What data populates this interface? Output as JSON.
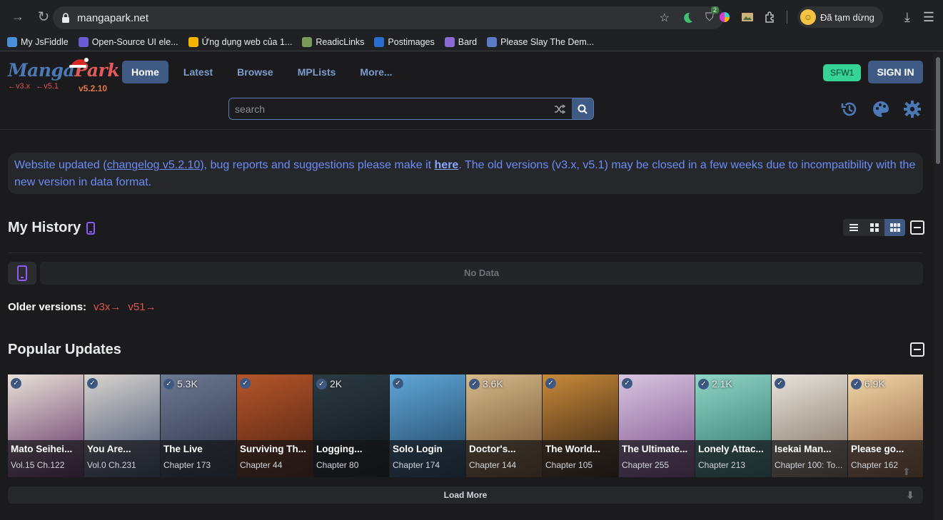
{
  "browser": {
    "url": "mangapark.net",
    "profile_status": "Đã tạm dừng",
    "extension_badge": "2",
    "bookmarks": [
      {
        "label": "My JsFiddle",
        "color": "#4a90d9"
      },
      {
        "label": "Open-Source UI ele...",
        "color": "#6b5bd6"
      },
      {
        "label": "Ứng dụng web của 1...",
        "color": "#f4b400"
      },
      {
        "label": "ReadicLinks",
        "color": "#7a9a5a"
      },
      {
        "label": "Postimages",
        "color": "#2b6ccf"
      },
      {
        "label": "Bard",
        "color": "#8a6bd6"
      },
      {
        "label": "Please Slay The Dem...",
        "color": "#5a7cc4"
      }
    ]
  },
  "site": {
    "logo_manga": "Manga",
    "logo_park": "Park",
    "legacy_v3": "←v3.x",
    "legacy_v5": "←v5.1",
    "version": "v5.2.10",
    "nav": [
      {
        "label": "Home",
        "active": true
      },
      {
        "label": "Latest",
        "active": false
      },
      {
        "label": "Browse",
        "active": false
      },
      {
        "label": "MPLists",
        "active": false
      },
      {
        "label": "More...",
        "active": false
      }
    ],
    "sfw_label": "SFW1",
    "signin_label": "SIGN IN",
    "search_placeholder": "search",
    "notice_pre": "Website updated (",
    "notice_link": "changelog v5.2.10",
    "notice_mid": "), bug reports and suggestions please make it ",
    "notice_here": "here",
    "notice_post": ". The old versions (v3.x, v5.1) may be closed in a few weeks due to incompatibility with the new version in data format.",
    "history_title": "My History",
    "nodata": "No Data",
    "older_label": "Older versions:",
    "older_v3": "v3x→",
    "older_v5": "v51→",
    "popular_title": "Popular Updates",
    "load_more": "Load More"
  },
  "cards": [
    {
      "name": "Mato Seihei...",
      "chapter": "Vol.15 Ch.122",
      "views": "",
      "c1": "#e9e2d8",
      "c2": "#5a2a5e"
    },
    {
      "name": "You Are...",
      "chapter": "Vol.0 Ch.231",
      "views": "",
      "c1": "#d9d4cf",
      "c2": "#3a4a6a"
    },
    {
      "name": "The Live",
      "chapter": "Chapter 173",
      "views": "5.3K",
      "c1": "#6e7a92",
      "c2": "#2a3045"
    },
    {
      "name": "Surviving Th...",
      "chapter": "Chapter 44",
      "views": "",
      "c1": "#b5562a",
      "c2": "#4a1f12"
    },
    {
      "name": "Logging...",
      "chapter": "Chapter 80",
      "views": "2K",
      "c1": "#2d3a44",
      "c2": "#0e1418"
    },
    {
      "name": "Solo Login",
      "chapter": "Chapter 174",
      "views": "",
      "c1": "#5fa7d8",
      "c2": "#1d3c5a"
    },
    {
      "name": "Doctor's...",
      "chapter": "Chapter 144",
      "views": "3.6K",
      "c1": "#d6b98a",
      "c2": "#6a4a2a"
    },
    {
      "name": "The World...",
      "chapter": "Chapter 105",
      "views": "",
      "c1": "#c88a3a",
      "c2": "#2a1a10"
    },
    {
      "name": "The Ultimate...",
      "chapter": "Chapter 255",
      "views": "",
      "c1": "#d8c6e0",
      "c2": "#7a4a8a"
    },
    {
      "name": "Lonely Attac...",
      "chapter": "Chapter 213",
      "views": "2.1K",
      "c1": "#8fd6c6",
      "c2": "#2f6f66"
    },
    {
      "name": "Isekai Man...",
      "chapter": "Chapter 100: To...",
      "views": "",
      "c1": "#e8e4dc",
      "c2": "#7a6a5a"
    },
    {
      "name": "Please go...",
      "chapter": "Chapter 162",
      "views": "6.9K",
      "c1": "#f2d6a8",
      "c2": "#8a5a3a"
    }
  ]
}
